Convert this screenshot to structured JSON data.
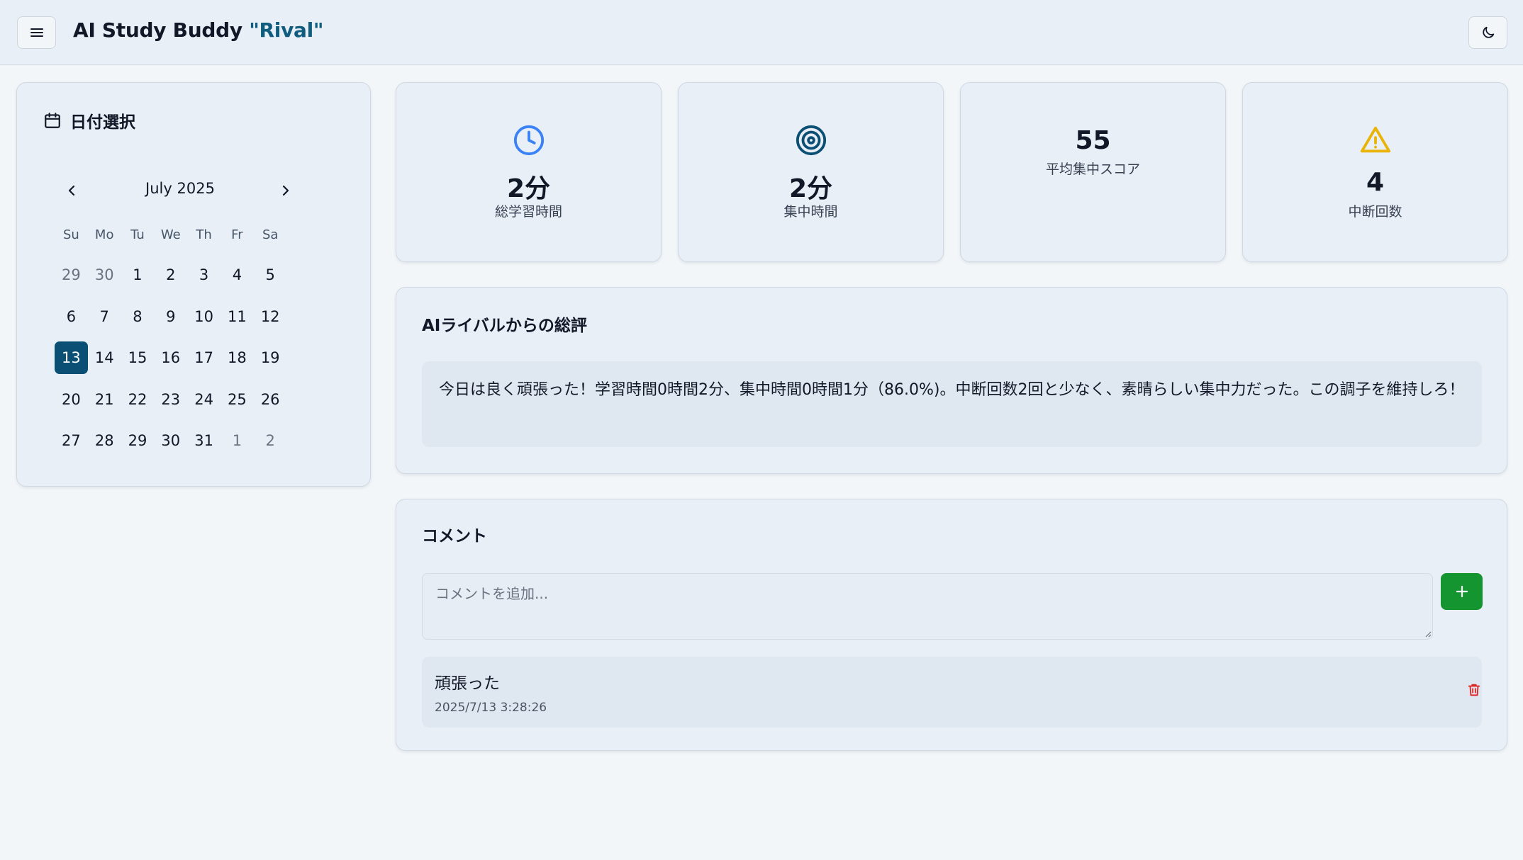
{
  "header": {
    "title_main": "AI Study Buddy ",
    "title_accent": "\"Rival\"",
    "menu_icon": "menu-icon",
    "theme_icon": "moon-icon"
  },
  "calendar": {
    "heading": "日付選択",
    "heading_icon": "calendar-icon",
    "month_label": "July 2025",
    "weekdays": [
      "Su",
      "Mo",
      "Tu",
      "We",
      "Th",
      "Fr",
      "Sa"
    ],
    "weeks": [
      [
        "29",
        "30",
        "1",
        "2",
        "3",
        "4",
        "5"
      ],
      [
        "6",
        "7",
        "8",
        "9",
        "10",
        "11",
        "12"
      ],
      [
        "13",
        "14",
        "15",
        "16",
        "17",
        "18",
        "19"
      ],
      [
        "20",
        "21",
        "22",
        "23",
        "24",
        "25",
        "26"
      ],
      [
        "27",
        "28",
        "29",
        "30",
        "31",
        "1",
        "2"
      ]
    ],
    "selected_day": "13"
  },
  "stats": [
    {
      "icon": "clock-icon",
      "value": "2分",
      "label": "総学習時間",
      "color": "#3b82f6"
    },
    {
      "icon": "target-icon",
      "value": "2分",
      "label": "集中時間",
      "color": "#0b4f74"
    },
    {
      "icon": "",
      "value": "55",
      "label": "平均集中スコア"
    },
    {
      "icon": "warning-icon",
      "value": "4",
      "label": "中断回数",
      "color": "#eab308"
    }
  ],
  "review": {
    "title": "AIライバルからの総評",
    "text": "今日は良く頑張った！学習時間0時間2分、集中時間0時間1分（86.0%)。中断回数2回と少なく、素晴らしい集中力だった。この調子を維持しろ！"
  },
  "comments": {
    "title": "コメント",
    "placeholder": "コメントを追加...",
    "add_icon": "plus-icon",
    "items": [
      {
        "text": "頑張った",
        "timestamp": "2025/7/13 3:28:26"
      }
    ]
  },
  "colors": {
    "accent": "#0e5c7e",
    "selected_day": "#0b4f74",
    "add_button": "#15952f",
    "delete": "#dc2626"
  }
}
